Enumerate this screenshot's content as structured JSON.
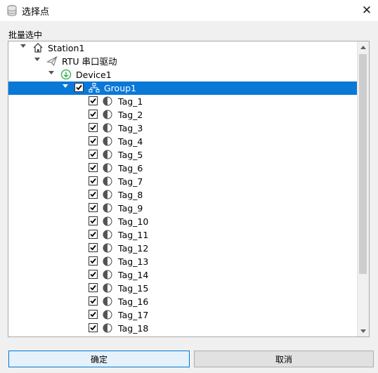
{
  "window": {
    "title": "选择点",
    "close_glyph": "✕"
  },
  "group_label": "批量选中",
  "tree": {
    "station": "Station1",
    "driver": "RTU 串口驱动",
    "device": "Device1",
    "group": "Group1",
    "tags": [
      "Tag_1",
      "Tag_2",
      "Tag_3",
      "Tag_4",
      "Tag_5",
      "Tag_6",
      "Tag_7",
      "Tag_8",
      "Tag_9",
      "Tag_10",
      "Tag_11",
      "Tag_12",
      "Tag_13",
      "Tag_14",
      "Tag_15",
      "Tag_16",
      "Tag_17",
      "Tag_18"
    ],
    "tags_checked": true,
    "group_checked": true,
    "selected_node": "Group1"
  },
  "icons": {
    "window": "database-icon",
    "station": "home-icon",
    "driver": "paper-plane-icon",
    "device": "download-circle-icon",
    "group": "network-icon",
    "tag": "half-circle-icon"
  },
  "colors": {
    "selection": "#0a78d7",
    "device_icon": "#2ea84a"
  },
  "buttons": {
    "ok": "确定",
    "cancel": "取消"
  }
}
